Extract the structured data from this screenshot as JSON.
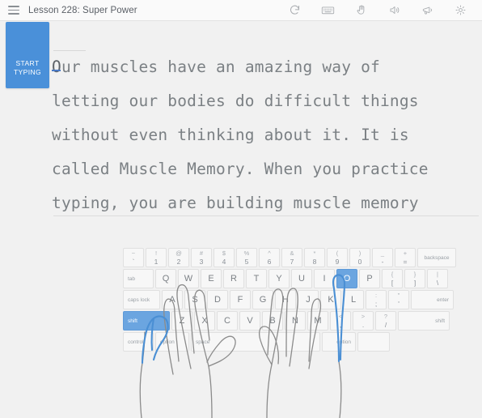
{
  "header": {
    "menu_icon": "hamburger-menu-icon",
    "lesson_title": "Lesson 228: Super Power",
    "tools": [
      {
        "name": "restart-icon",
        "label": "restart"
      },
      {
        "name": "keyboard-icon",
        "label": "keyboard"
      },
      {
        "name": "hand-icon",
        "label": "hands"
      },
      {
        "name": "speaker-icon",
        "label": "sound"
      },
      {
        "name": "megaphone-icon",
        "label": "voice"
      },
      {
        "name": "gear-icon",
        "label": "settings"
      }
    ]
  },
  "start_button": {
    "line1": "START",
    "line2": "TYPING"
  },
  "lesson_text": {
    "cursor_char": "O",
    "first_line_rest": "ur muscles have an amazing way of",
    "lines": [
      "letting our bodies do difficult things",
      "without even thinking about it. It is",
      "called Muscle Memory. When you practice",
      "typing, you are building muscle memory"
    ]
  },
  "colors": {
    "accent_blue": "#4a90d9",
    "key_highlight": "#6ba5e0",
    "cursor_blue": "#4a79c4",
    "finger_highlight": "#4a8fd4",
    "background": "#f1f1f1",
    "text_gray": "#7b8084"
  },
  "keyboard": {
    "row1": [
      {
        "top": "~",
        "bot": "`"
      },
      {
        "top": "!",
        "bot": "1"
      },
      {
        "top": "@",
        "bot": "2"
      },
      {
        "top": "#",
        "bot": "3"
      },
      {
        "top": "$",
        "bot": "4"
      },
      {
        "top": "%",
        "bot": "5"
      },
      {
        "top": "^",
        "bot": "6"
      },
      {
        "top": "&",
        "bot": "7"
      },
      {
        "top": "*",
        "bot": "8"
      },
      {
        "top": "(",
        "bot": "9"
      },
      {
        "top": ")",
        "bot": "0"
      },
      {
        "top": "_",
        "bot": "-"
      },
      {
        "top": "+",
        "bot": "="
      }
    ],
    "row1_backspace": "backspace",
    "row2_tab": "tab",
    "row2": [
      "Q",
      "W",
      "E",
      "R",
      "T",
      "Y",
      "U",
      "I",
      "O",
      "P"
    ],
    "row2_highlight": "O",
    "row2_extra": [
      {
        "top": "{",
        "bot": "["
      },
      {
        "top": "}",
        "bot": "]"
      },
      {
        "top": "|",
        "bot": "\\"
      }
    ],
    "row3_caps": "caps lock",
    "row3": [
      "A",
      "S",
      "D",
      "F",
      "G",
      "H",
      "J",
      "K",
      "L"
    ],
    "row3_extra": [
      {
        "top": ":",
        "bot": ";"
      },
      {
        "top": "\"",
        "bot": "'"
      }
    ],
    "row3_enter": "enter",
    "row4_shift_left": "shift",
    "row4_shift_left_highlight": true,
    "row4": [
      "Z",
      "X",
      "C",
      "V",
      "B",
      "N",
      "M"
    ],
    "row4_extra": [
      {
        "top": "<",
        "bot": ","
      },
      {
        "top": ">",
        "bot": "."
      },
      {
        "top": "?",
        "bot": "/"
      }
    ],
    "row4_shift_right": "shift",
    "row5": [
      "control",
      "option",
      "space",
      "option"
    ]
  }
}
